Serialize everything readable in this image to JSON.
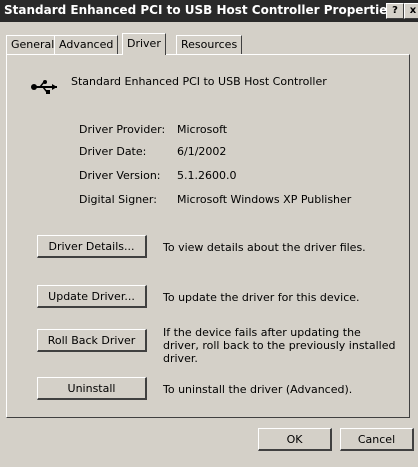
{
  "window": {
    "title": "Standard Enhanced PCI to USB Host Controller Properties",
    "help_button": "?",
    "close_button": "x"
  },
  "tabs": [
    {
      "label": "General"
    },
    {
      "label": "Advanced"
    },
    {
      "label": "Driver"
    },
    {
      "label": "Resources"
    }
  ],
  "device": {
    "name": "Standard Enhanced PCI to USB Host Controller",
    "icon": "usb-icon"
  },
  "info": [
    {
      "label": "Driver Provider:",
      "value": "Microsoft"
    },
    {
      "label": "Driver Date:",
      "value": "6/1/2002"
    },
    {
      "label": "Driver Version:",
      "value": "5.1.2600.0"
    },
    {
      "label": "Digital Signer:",
      "value": "Microsoft Windows XP Publisher"
    }
  ],
  "actions": [
    {
      "button": "Driver Details...",
      "description": "To view details about the driver files."
    },
    {
      "button": "Update Driver...",
      "description": "To update the driver for this device."
    },
    {
      "button": "Roll Back Driver",
      "description": "If the device fails after updating the driver, roll back to the previously installed driver."
    },
    {
      "button": "Uninstall",
      "description": "To uninstall the driver (Advanced)."
    }
  ],
  "footer": {
    "ok": "OK",
    "cancel": "Cancel"
  }
}
